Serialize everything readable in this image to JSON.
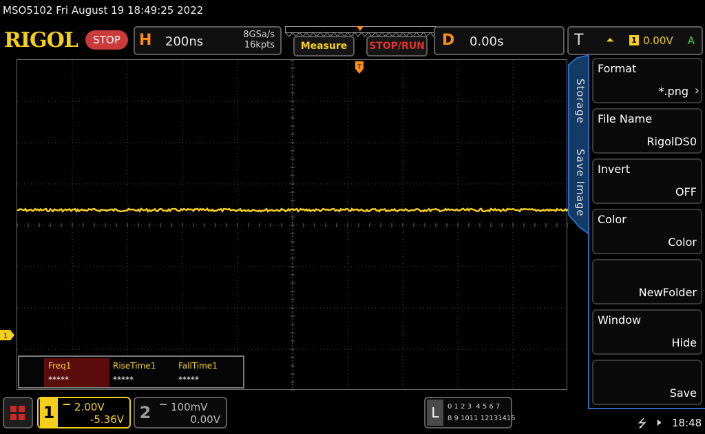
{
  "titlebar": "MSO5102  Fri August 19 18:49:25 2022",
  "logo": "RIGOL",
  "run_status": "STOP",
  "horizontal": {
    "letter": "H",
    "timebase": "200ns",
    "sample_rate": "8GSa/s",
    "memory_depth": "16kpts"
  },
  "buttons": {
    "measure": "Measure",
    "stop_run": "STOP/RUN"
  },
  "delay": {
    "letter": "D",
    "value": "0.00s"
  },
  "trigger": {
    "letter": "T",
    "source": "1",
    "level": "0.00V",
    "mode": "A",
    "slope_icon": "rising-edge-icon"
  },
  "measurements": [
    {
      "name": "Freq1",
      "value": "*****"
    },
    {
      "name": "RiseTime1",
      "value": "*****"
    },
    {
      "name": "FallTime1",
      "value": "*****"
    }
  ],
  "menu": {
    "tabs": [
      "Storage",
      "Save Image"
    ],
    "items": [
      {
        "title": "Format",
        "value": "*.png",
        "state": "active"
      },
      {
        "title": "File Name",
        "value": "RigolDS0",
        "state": "dim"
      },
      {
        "title": "Invert",
        "value": "OFF",
        "state": "dim"
      },
      {
        "title": "Color",
        "value": "Color",
        "state": "dim"
      },
      {
        "title": "",
        "value": "NewFolder",
        "state": "dim"
      },
      {
        "title": "Window",
        "value": "Hide",
        "state": "dim"
      },
      {
        "title": "",
        "value": "Save",
        "state": "dim"
      }
    ]
  },
  "ch1": {
    "num": "1",
    "scale": "2.00V",
    "offset": "-5.36V",
    "marker": "1"
  },
  "ch2": {
    "num": "2",
    "scale": "100mV",
    "offset": "0.00V"
  },
  "la": {
    "letter": "L",
    "row1": "0 1 2 3  4 5 6 7",
    "row2": "8 9 1011 12131415"
  },
  "clock": "18:48",
  "colors": {
    "ch1": "#f5cf1b",
    "accent": "#ff8c1a",
    "menu_border": "#2a6bbf",
    "stop": "#cc3b3b"
  }
}
